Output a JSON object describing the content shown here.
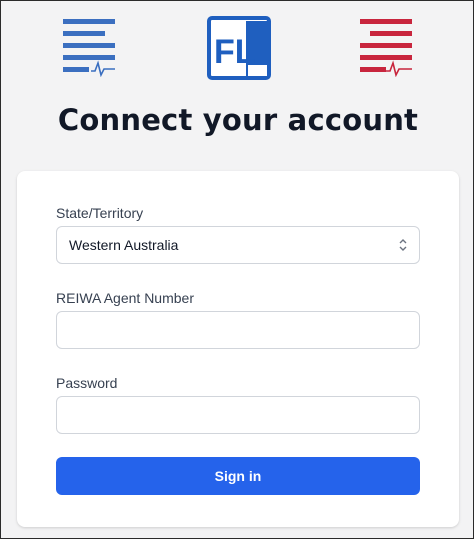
{
  "header": {
    "title": "Connect your account",
    "center_logo_text": "FL"
  },
  "colors": {
    "left_logo": "#3b6fc0",
    "right_logo": "#c8253d",
    "center_logo": "#1f5fbf",
    "button": "#2563eb"
  },
  "icons": {
    "left_logo": "document-pulse-icon",
    "right_logo": "document-pulse-icon",
    "select_chevron": "chevron-up-down-icon"
  },
  "form": {
    "state_label": "State/Territory",
    "state_value": "Western Australia",
    "agent_label": "REIWA Agent Number",
    "agent_value": "",
    "password_label": "Password",
    "password_value": "",
    "signin_label": "Sign in"
  }
}
